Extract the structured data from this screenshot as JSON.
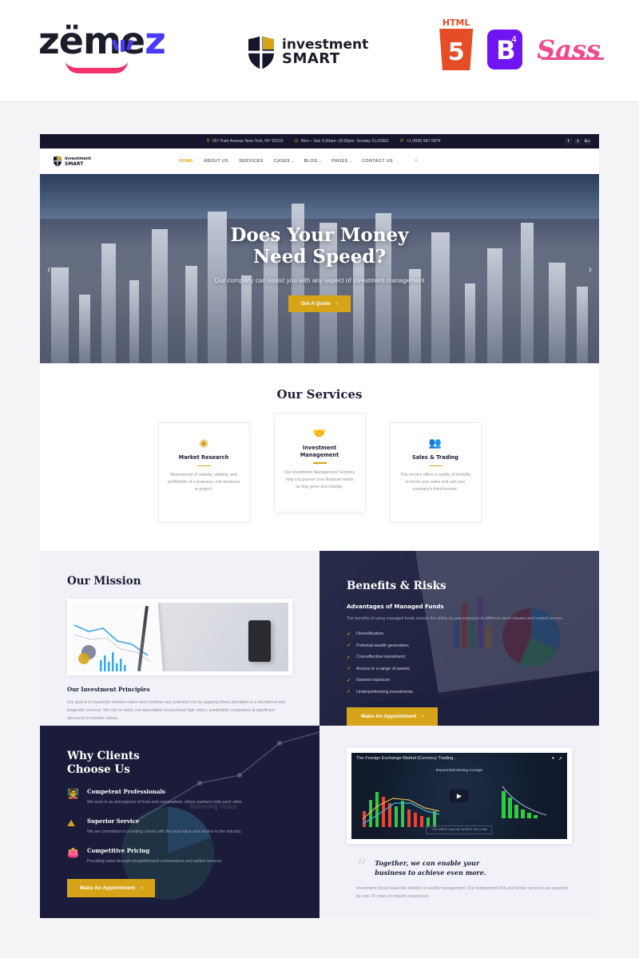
{
  "brandstrip": {
    "zemez_logo": "zemez",
    "zemez_part1": "z",
    "zemez_part2": "me",
    "zemez_part3": "z",
    "product_logo_line1": "investment",
    "product_logo_line2": "SMART",
    "badges": [
      {
        "name": "html5-badge",
        "label": "HTML",
        "glyph": "5"
      },
      {
        "name": "bootstrap4-badge",
        "label": "B",
        "glyph": "4"
      },
      {
        "name": "sass-badge",
        "label": "Sass"
      }
    ]
  },
  "site": {
    "contactbar": {
      "address": "267 Park Avenue New York, NY 90210",
      "hours": "Mon – Sat: 9.00am–18.00pm. Sunday CLOSED",
      "phone": "+1 (409) 987-5874",
      "address_icon": "location-pin-icon",
      "hours_icon": "clock-icon",
      "phone_icon": "phone-icon",
      "social": [
        {
          "name": "facebook-icon",
          "glyph": "f"
        },
        {
          "name": "twitter-icon",
          "glyph": "t"
        },
        {
          "name": "google-plus-icon",
          "glyph": "G+"
        }
      ]
    },
    "nav": {
      "logo_line1": "investment",
      "logo_line2": "SMART",
      "items": [
        {
          "label": "HOME",
          "active": true,
          "caret": false
        },
        {
          "label": "ABOUT US",
          "active": false,
          "caret": false
        },
        {
          "label": "SERVICES",
          "active": false,
          "caret": false
        },
        {
          "label": "CASES",
          "active": false,
          "caret": true
        },
        {
          "label": "BLOG",
          "active": false,
          "caret": true
        },
        {
          "label": "PAGES",
          "active": false,
          "caret": true
        },
        {
          "label": "CONTACT US",
          "active": false,
          "caret": false
        }
      ],
      "search_icon": "search-icon"
    },
    "hero": {
      "title_line1": "Does Your Money",
      "title_line2": "Need Speed?",
      "subtitle": "Our company can assist you with any aspect of investment management",
      "cta": "Get A Quote",
      "cta_arrow": "›",
      "prev_arrow": "‹",
      "next_arrow": "›"
    },
    "services": {
      "title": "Our Services",
      "cards": [
        {
          "icon": "eye-icon",
          "glyph": "◉",
          "name": "Market Research",
          "text": "Assessment of viability, stability, and profitability of a business, sub-business or project."
        },
        {
          "icon": "handshake-icon",
          "glyph": "🤝",
          "name": "Investment Management",
          "text": "Our Investment Management Services help you pursue your financial needs as they grow and change."
        },
        {
          "icon": "people-icon",
          "glyph": "👥",
          "name": "Sales & Trading",
          "text": "This service offers a variety of benefits to boost your sales and suit your company's fixed income."
        }
      ]
    },
    "mission": {
      "title": "Our Mission",
      "image_name": "investment-chart-photo",
      "subtitle": "Our Investment Principles",
      "text": "Our goal is to maximize investor return and minimize any potential loss by applying these principles in a disciplined and pragmatic process. We rely on facts, not speculation to purchase high return, predictable companies at significant discounts to intrinsic values."
    },
    "benefits": {
      "title": "Benefits & Risks",
      "subtitle": "Advantages of Managed Funds",
      "lead": "The benefits of using managed funds include the ability to gain exposure to different asset classes and market sectors.",
      "items": [
        "Diversification;",
        "Potential wealth generation;",
        "Cost-effective investment;",
        "Access to a range of assets;",
        "Geared exposure;",
        "Underperforming investments."
      ],
      "check_icon": "check-icon",
      "cta": "Make An Appointment",
      "cta_arrow": "›"
    },
    "why": {
      "title_line1": "Why Clients",
      "title_line2": "Choose Us",
      "features": [
        {
          "icon": "presenter-icon",
          "glyph": "🧑‍🏫",
          "title": "Competent Professionals",
          "text": "We work in an atmosphere of trust and camaraderie, where partners help each other."
        },
        {
          "icon": "mountain-flag-icon",
          "glyph": "⛰",
          "title": "Superior Service",
          "text": "We are committed to providing clients with the best value and service in the industry."
        },
        {
          "icon": "wallet-icon",
          "glyph": "👛",
          "title": "Competitive Pricing",
          "text": "Providing value through straightforward commissions and added services."
        }
      ],
      "cta": "Make An Appointment",
      "cta_arrow": "›"
    },
    "video": {
      "title": "The Foreign Exchange Market |Currency Trading...",
      "watch_later_icon": "watch-later-icon",
      "share_icon": "share-icon",
      "play_icon": "play-icon",
      "chart_label": "Exponential Moving Average",
      "footer_note": "YOU TUBING\nLearn Lab The MEHT / Be on Vida"
    },
    "testimonial": {
      "quote_mark": "“",
      "quote_line1": "Together, we can enable your",
      "quote_line2": "business to achieve even more.",
      "body": "Investment Smart leads the industry in wealth management. Our independent RIA and broker services are powered by over 20 years of industry experience."
    }
  },
  "colors": {
    "gold": "#d6a419",
    "dark_navy": "#15162b",
    "panel_navy": "#1c1e3c",
    "page_bg": "#f4f4f7",
    "brand_purple": "#4a3aff",
    "brand_pink": "#f5316c"
  }
}
